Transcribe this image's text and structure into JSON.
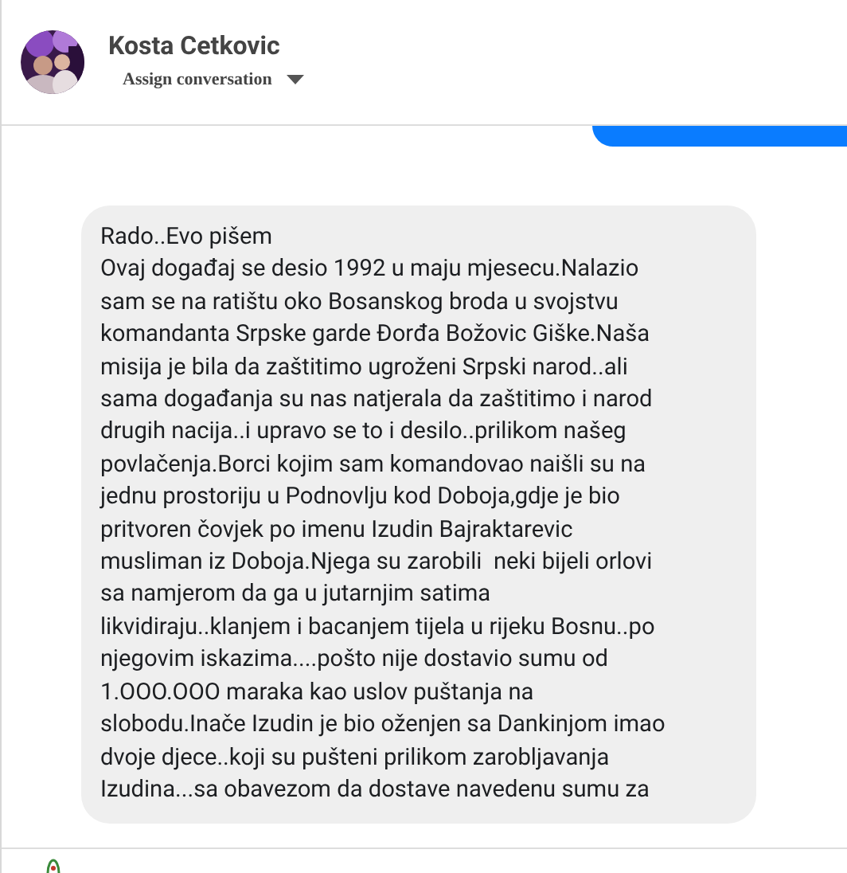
{
  "header": {
    "name": "Kosta Cetkovic",
    "assign": "Assign conversation"
  },
  "messages": [
    {
      "kind": "outgoing"
    },
    {
      "kind": "incoming",
      "text": "Rado..Evo pišem\nOvaj događaj se desio 1992 u maju mjesecu.Nalazio\nsam se na ratištu oko Bosanskog broda u svojstvu\nkomandanta Srpske garde Đorđa Božovic Giške.Naša\nmisija je bila da zaštitimo ugroženi Srpski narod..ali\nsama događanja su nas natjerala da zaštitimo i narod\ndrugih nacija..i upravo se to i desilo..prilikom našeg\npovlačenja.Borci kojim sam komandovao naišli su na\njednu prostoriju u Podnovlju kod Doboja,gdje je bio\npritvoren čovjek po imenu Izudin Bajraktarevic\nmusliman iz Doboja.Njega su zarobili  neki bijeli orlovi\nsa namjerom da ga u jutarnjim satima\nlikvidiraju..klanjem i bacanjem tijela u rijeku Bosnu..po\nnjegovim iskazima....pošto nije dostavio sumu od\n1.OOO.OOO maraka kao uslov puštanja na\nslobodu.Inače Izudin je bio oženjen sa Dankinjom imao\ndvoje djece..koji su pušteni prilikom zarobljavanja\nIzudina...sa obavezom da dostave navedenu sumu za"
    }
  ]
}
